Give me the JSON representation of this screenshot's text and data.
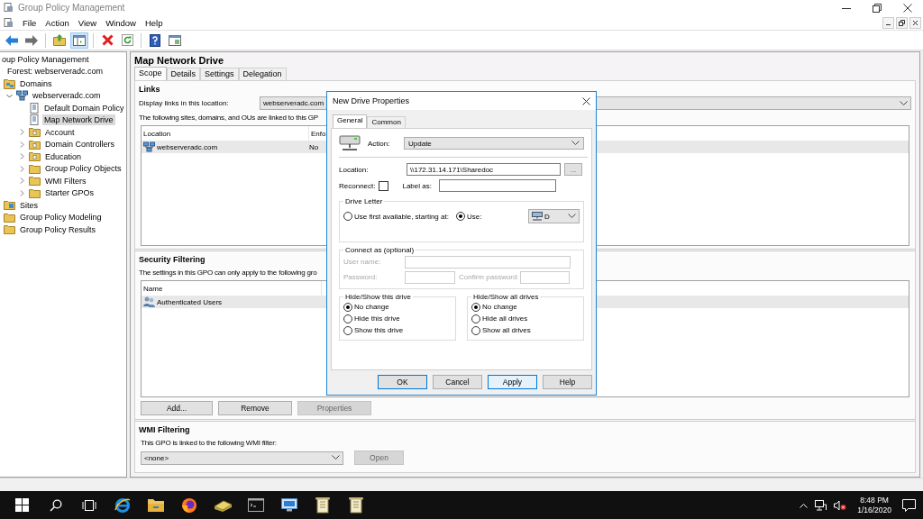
{
  "window": {
    "title": "Group Policy Management"
  },
  "menu": [
    "File",
    "Action",
    "View",
    "Window",
    "Help"
  ],
  "toolbar": [
    {
      "kind": "back",
      "pressed": false
    },
    {
      "kind": "forward",
      "pressed": false
    },
    {
      "kind": "sep"
    },
    {
      "kind": "up",
      "pressed": false
    },
    {
      "kind": "tree",
      "pressed": true
    },
    {
      "kind": "sep"
    },
    {
      "kind": "delete",
      "pressed": false
    },
    {
      "kind": "refresh",
      "pressed": false
    },
    {
      "kind": "sep"
    },
    {
      "kind": "help",
      "pressed": false
    },
    {
      "kind": "pane",
      "pressed": false
    }
  ],
  "tree": [
    {
      "label": "oup Policy Management",
      "selected": false,
      "children": [
        {
          "label": "Forest: webserveradc.com",
          "selected": false,
          "children": [
            {
              "label": "Domains",
              "kind": "domains",
              "selected": false,
              "children": [
                {
                  "label": "webserveradc.com",
                  "kind": "domain",
                  "expanded": true,
                  "selected": false,
                  "children": [
                    {
                      "label": "Default Domain Policy",
                      "kind": "gpo",
                      "selected": false
                    },
                    {
                      "label": "Map Network Drive",
                      "kind": "gpo",
                      "selected": true
                    },
                    {
                      "label": "Account",
                      "kind": "ou",
                      "expanded": false,
                      "selected": false
                    },
                    {
                      "label": "Domain Controllers",
                      "kind": "ou",
                      "expanded": false,
                      "selected": false
                    },
                    {
                      "label": "Education",
                      "kind": "ou",
                      "expanded": false,
                      "selected": false
                    },
                    {
                      "label": "Group Policy Objects",
                      "kind": "folder",
                      "expanded": false,
                      "selected": false
                    },
                    {
                      "label": "WMI Filters",
                      "kind": "folder",
                      "expanded": false,
                      "selected": false
                    },
                    {
                      "label": "Starter GPOs",
                      "kind": "folder",
                      "expanded": false,
                      "selected": false
                    }
                  ]
                }
              ]
            },
            {
              "label": "Sites",
              "kind": "sites",
              "selected": false
            },
            {
              "label": "Group Policy Modeling",
              "kind": "folder",
              "selected": false
            },
            {
              "label": "Group Policy Results",
              "kind": "folder",
              "selected": false
            }
          ]
        }
      ]
    }
  ],
  "details": {
    "title": "Map Network Drive",
    "tabs": [
      {
        "label": "Scope",
        "selected": true
      },
      {
        "label": "Details",
        "selected": false
      },
      {
        "label": "Settings",
        "selected": false
      },
      {
        "label": "Delegation",
        "selected": false
      }
    ],
    "links": {
      "heading": "Links",
      "display_label": "Display links in this location:",
      "display_value": "webserveradc.com",
      "note": "The following sites, domains, and OUs are linked to this GP",
      "columns": [
        "Location",
        "Enfo"
      ],
      "rows": [
        {
          "cells": [
            "webserveradc.com",
            "No"
          ],
          "selected": true
        }
      ]
    },
    "security": {
      "heading": "Security Filtering",
      "note": "The settings in this GPO can only apply to the following gro",
      "columns": [
        "Name"
      ],
      "rows": [
        {
          "cells": [
            "Authenticated Users"
          ],
          "selected": true
        }
      ],
      "buttons": [
        {
          "label": "Add...",
          "disabled": false
        },
        {
          "label": "Remove",
          "disabled": false
        },
        {
          "label": "Properties",
          "disabled": true
        }
      ]
    },
    "wmi": {
      "heading": "WMI Filtering",
      "note": "This GPO is linked to the following WMI filter:",
      "value": "<none>",
      "button": {
        "label": "Open",
        "disabled": true
      }
    }
  },
  "dialog": {
    "title": "New Drive Properties",
    "tabs": [
      {
        "label": "General",
        "selected": true
      },
      {
        "label": "Common",
        "selected": false
      }
    ],
    "action_label": "Action:",
    "action_value": "Update",
    "location_label": "Location:",
    "location_value": "\\\\172.31.14.171\\Sharedoc",
    "browse_label": "...",
    "reconnect_label": "Reconnect:",
    "reconnect_checked": false,
    "label_as_label": "Label as:",
    "drive_letter": {
      "legend": "Drive Letter",
      "options": [
        {
          "label": "Use first available, starting at:",
          "selected": false
        },
        {
          "label": "Use:",
          "selected": true
        }
      ],
      "letter": "D"
    },
    "connect_as": {
      "legend": "Connect as (optional)",
      "disabled": true,
      "user_label": "User name:",
      "password_label": "Password:",
      "confirm_label": "Confirm password:"
    },
    "hide_show_this": {
      "legend": "Hide/Show this drive",
      "options": [
        {
          "label": "No change",
          "selected": true
        },
        {
          "label": "Hide this drive",
          "selected": false
        },
        {
          "label": "Show this drive",
          "selected": false
        }
      ]
    },
    "hide_show_all": {
      "legend": "Hide/Show all drives",
      "options": [
        {
          "label": "No change",
          "selected": true
        },
        {
          "label": "Hide all drives",
          "selected": false
        },
        {
          "label": "Show all drives",
          "selected": false
        }
      ]
    },
    "buttons": [
      {
        "label": "OK",
        "default": true,
        "highlighted": false
      },
      {
        "label": "Cancel",
        "default": false,
        "highlighted": false
      },
      {
        "label": "Apply",
        "default": false,
        "highlighted": true
      },
      {
        "label": "Help",
        "default": false,
        "highlighted": false
      }
    ]
  },
  "taskbar": {
    "apps": [
      {
        "kind": "start"
      },
      {
        "kind": "search"
      },
      {
        "kind": "taskview"
      },
      {
        "kind": "browser"
      },
      {
        "kind": "explorer"
      },
      {
        "kind": "firefox"
      },
      {
        "kind": "server"
      },
      {
        "kind": "cmd"
      },
      {
        "kind": "monitor"
      },
      {
        "kind": "scroll"
      },
      {
        "kind": "scroll"
      }
    ],
    "time": "8:48 PM",
    "date": "1/16/2020"
  }
}
